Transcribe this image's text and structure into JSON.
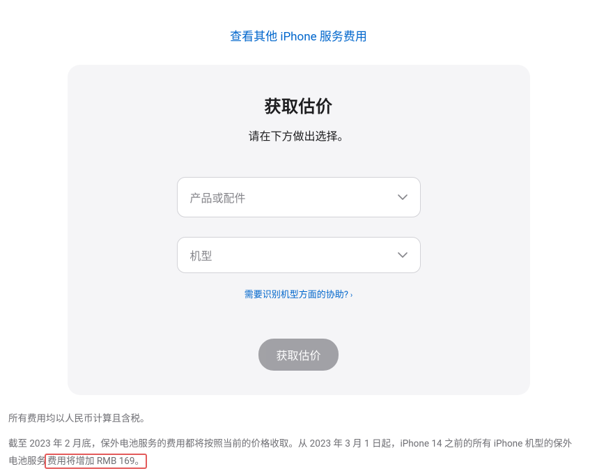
{
  "topLink": {
    "label": "查看其他 iPhone 服务费用"
  },
  "card": {
    "title": "获取估价",
    "subtitle": "请在下方做出选择。",
    "selectProduct": {
      "placeholder": "产品或配件"
    },
    "selectModel": {
      "placeholder": "机型"
    },
    "helpLink": {
      "label": "需要识别机型方面的协助?",
      "chevron": "›"
    },
    "submit": {
      "label": "获取估价"
    }
  },
  "footnote": {
    "line1": "所有费用均以人民币计算且含税。",
    "line2a": "截至 2023 年 2 月底，保外电池服务的费用都将按照当前的价格收取。从 2023 年 3 月 1 日起，iPhone 14 之前的所有 iPhone 机型的保外电池服务",
    "line2b": "费用将增加 RMB 169。"
  }
}
